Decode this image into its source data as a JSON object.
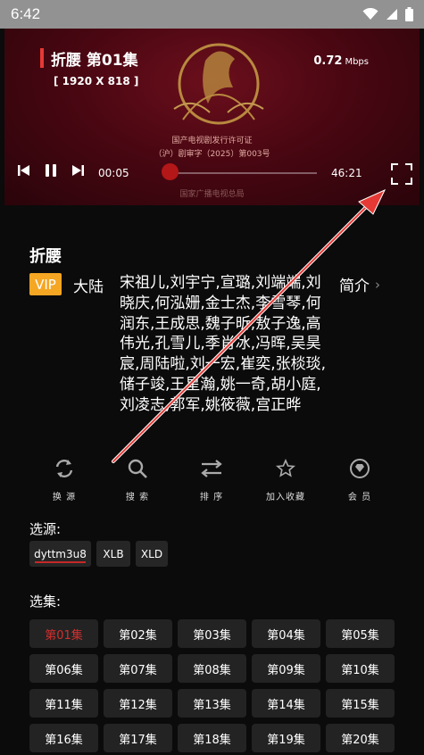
{
  "status_bar": {
    "time": "6:42"
  },
  "player": {
    "title": "折腰 第01集",
    "resolution": "[ 1920 X 818 ]",
    "speed_value": "0.72",
    "speed_unit": "Mbps",
    "license_line1": "国产电视剧发行许可证",
    "license_line2": "（沪）剧审字（2025）第003号",
    "watermark": "国家广播电视总局",
    "current_time": "00:05",
    "total_time": "46:21",
    "progress": 0.002
  },
  "info": {
    "name": "折腰",
    "badge": "VIP",
    "region": "大陆",
    "cast": "宋祖儿,刘宇宁,宣璐,刘端端,刘晓庆,何泓姗,金士杰,李雪琴,何润东,王成思,魏子昕,敖子逸,高伟光,孔雪儿,季肖冰,冯晖,吴昊宸,周陆啦,刘一宏,崔奕,张棪琰,储子竣,王星瀚,姚一奇,胡小庭,刘凌志,郭军,姚筱薇,宫正晔",
    "intro_label": "简介"
  },
  "actions": [
    {
      "label": "换 源",
      "icon": "refresh-icon"
    },
    {
      "label": "搜 索",
      "icon": "search-icon"
    },
    {
      "label": "排 序",
      "icon": "sort-icon"
    },
    {
      "label": "加入收藏",
      "icon": "star-icon"
    },
    {
      "label": "会 员",
      "icon": "diamond-icon"
    }
  ],
  "sources": {
    "label": "选源:",
    "items": [
      "dyttm3u8",
      "XLB",
      "XLD"
    ],
    "selected": 0
  },
  "episodes": {
    "label": "选集:",
    "items": [
      "第01集",
      "第02集",
      "第03集",
      "第04集",
      "第05集",
      "第06集",
      "第07集",
      "第08集",
      "第09集",
      "第10集",
      "第11集",
      "第12集",
      "第13集",
      "第14集",
      "第15集",
      "第16集",
      "第17集",
      "第18集",
      "第19集",
      "第20集"
    ],
    "selected": 0
  },
  "colors": {
    "accent": "#d32f2f",
    "vip": "#f5a623",
    "annotation_arrow": "#e53935"
  }
}
